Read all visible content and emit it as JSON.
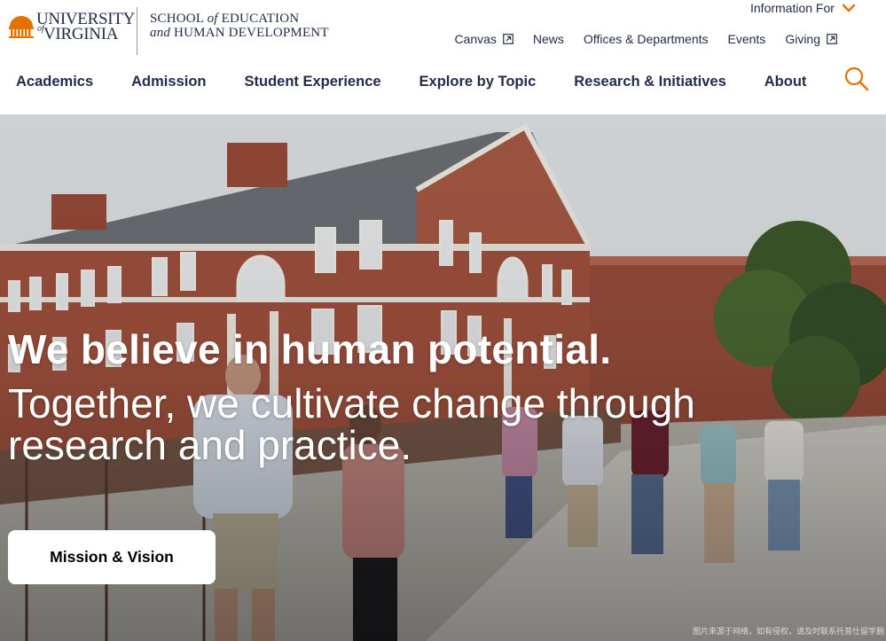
{
  "logo": {
    "university_line1": "UNIVERSITY",
    "university_of": "of",
    "university_line2": "VIRGINIA",
    "school_line1_a": "SCHOOL ",
    "school_line1_of": "of",
    "school_line1_b": " EDUCATION",
    "school_line2_and": "and",
    "school_line2_b": " HUMAN DEVELOPMENT"
  },
  "info_for": {
    "label": "Information For",
    "icon": "chevron-down-icon",
    "color": "#e57200"
  },
  "utility_nav": [
    {
      "label": "Canvas",
      "external": true
    },
    {
      "label": "News",
      "external": false
    },
    {
      "label": "Offices & Departments",
      "external": false
    },
    {
      "label": "Events",
      "external": false
    },
    {
      "label": "Giving",
      "external": true
    }
  ],
  "main_nav": [
    {
      "label": "Academics"
    },
    {
      "label": "Admission"
    },
    {
      "label": "Student Experience"
    },
    {
      "label": "Explore by Topic"
    },
    {
      "label": "Research & Initiatives"
    },
    {
      "label": "About"
    }
  ],
  "search": {
    "icon": "search-icon",
    "color": "#e57200"
  },
  "hero": {
    "title": "We believe in human potential.",
    "subtitle": "Together, we cultivate change through research and practice.",
    "button_label": "Mission & Vision",
    "watermark": "图片来源于网络，如有侵权，请及时联系托普仕留学删"
  },
  "colors": {
    "navy": "#232d4b",
    "orange": "#e57200",
    "brick": "#8e4a3a"
  }
}
